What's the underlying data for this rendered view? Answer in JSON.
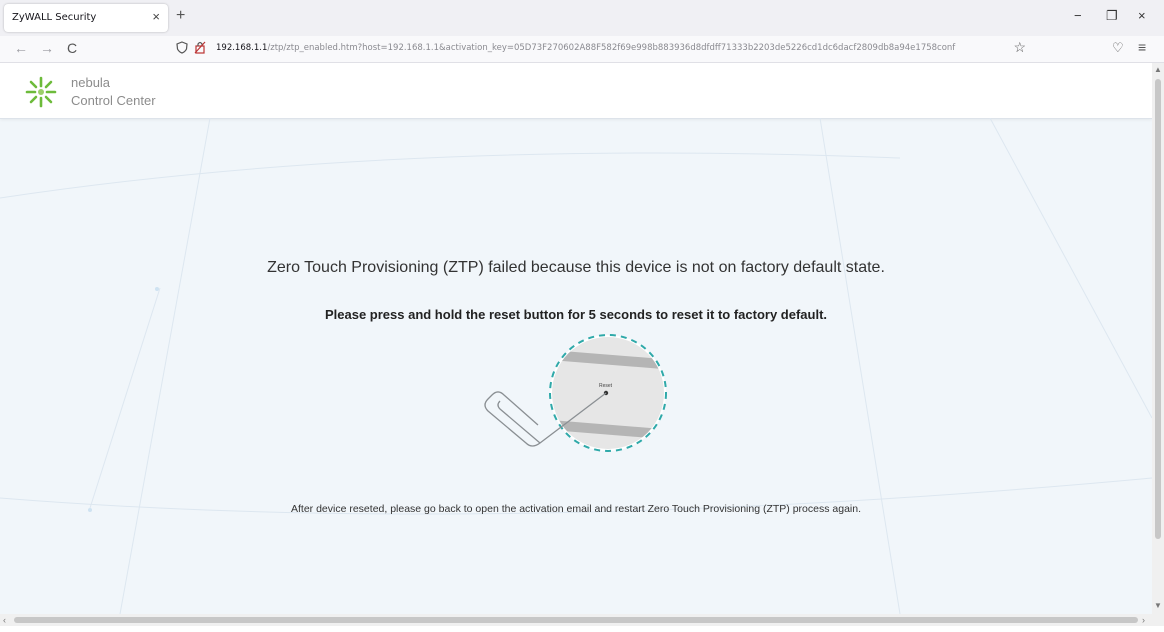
{
  "browser": {
    "tab_title": "ZyWALL Security",
    "tab_close": "×",
    "new_tab": "+",
    "window_controls": {
      "minimize": "−",
      "restore": "❐",
      "close": "×"
    },
    "nav": {
      "back": "←",
      "forward": "→",
      "reload": "C"
    },
    "url_host": "192.168.1.1",
    "url_rest": "/ztp/ztp_enabled.htm?host=192.168.1.1&activation_key=05D73F270602A88F582f69e998b883936d8dfdff71333b2203de5226cd1dc6dacf2809db8a94e1758conf",
    "bookmark_star": "☆",
    "pocket": "♡",
    "menu": "≡"
  },
  "header": {
    "logo_line1": "nebula",
    "logo_line2": "Control Center"
  },
  "main": {
    "headline": "Zero Touch Provisioning (ZTP) failed because this device is not on factory default state.",
    "instruction": "Please press and hold the reset button for 5 seconds to reset it to factory default.",
    "reset_label": "Reset",
    "footer_note": "After device reseted, please go back to open the activation email and restart Zero Touch Provisioning (ZTP) process again."
  },
  "scrollbars": {
    "up": "▲",
    "down": "▼",
    "left": "‹",
    "right": "›"
  },
  "colors": {
    "page_bg": "#f1f6fa",
    "dashed_ring": "#2fa9a9",
    "logo_green": "#6dbb3b"
  },
  "icons": [
    "shield-icon",
    "lock-icon",
    "star-icon",
    "pocket-icon",
    "menu-icon",
    "nebula-logo-icon",
    "paperclip-icon"
  ]
}
